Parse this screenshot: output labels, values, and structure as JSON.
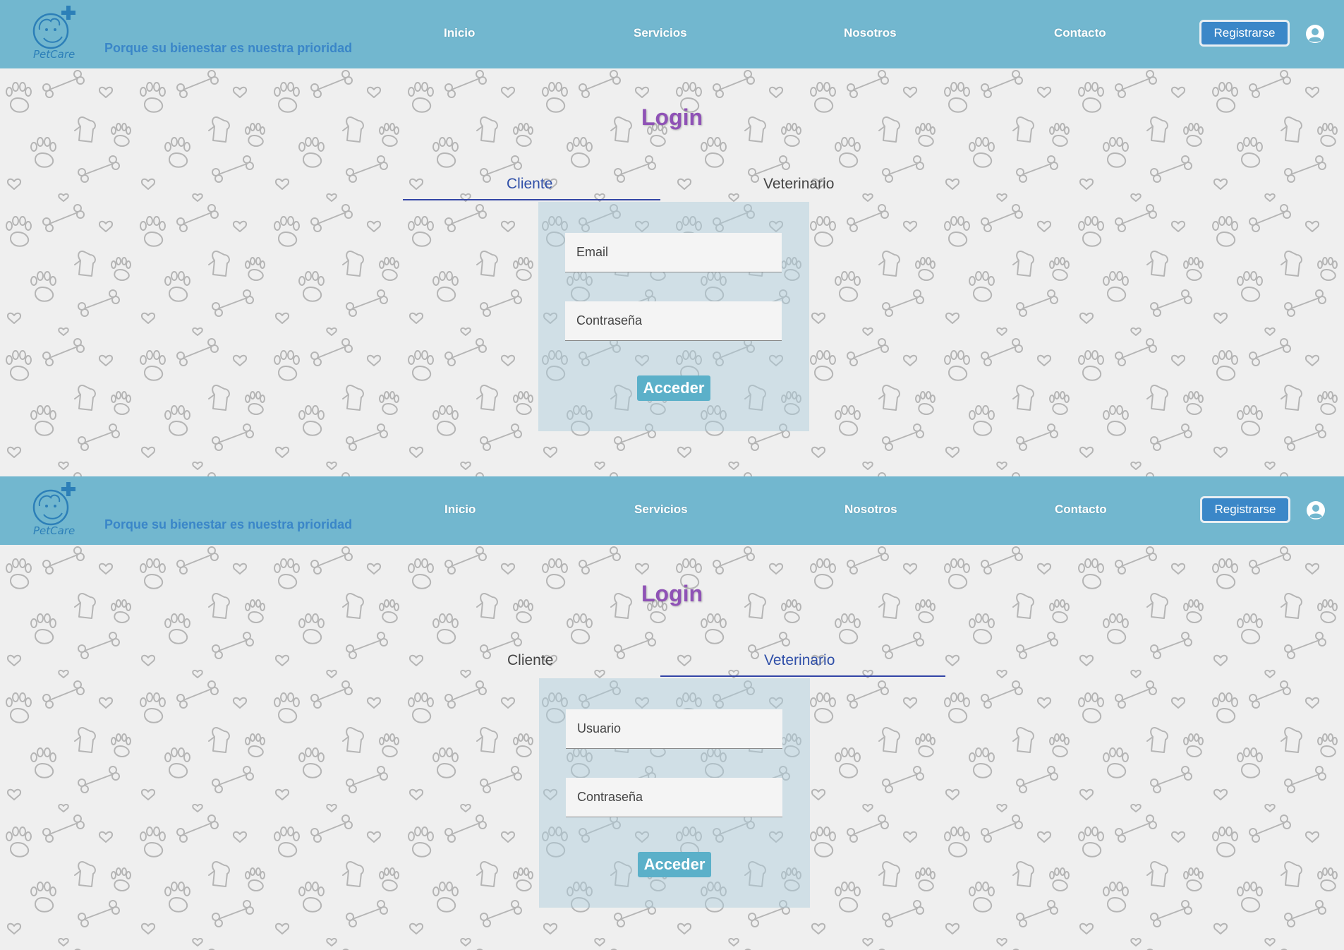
{
  "brand": {
    "name": "PetCare",
    "tagline": "Porque su bienestar es nuestra prioridad"
  },
  "nav": {
    "links": [
      "Inicio",
      "Servicios",
      "Nosotros",
      "Contacto"
    ],
    "register_label": "Registrarse"
  },
  "colors": {
    "header": "#72b7cf",
    "title": "#8f52b6",
    "active_tab": "#2f4fa8",
    "button": "#5bb0c9",
    "register": "#3b87c8"
  },
  "views": [
    {
      "title": "Login",
      "tabs": [
        "Cliente",
        "Veterinario"
      ],
      "active_tab": "Cliente",
      "fields": [
        {
          "placeholder": "Email",
          "type": "email"
        },
        {
          "placeholder": "Contraseña",
          "type": "password"
        }
      ],
      "submit_label": "Acceder"
    },
    {
      "title": "Login",
      "tabs": [
        "Cliente",
        "Veterinario"
      ],
      "active_tab": "Veterinario",
      "fields": [
        {
          "placeholder": "Usuario",
          "type": "text"
        },
        {
          "placeholder": "Contraseña",
          "type": "password"
        }
      ],
      "submit_label": "Acceder"
    }
  ]
}
